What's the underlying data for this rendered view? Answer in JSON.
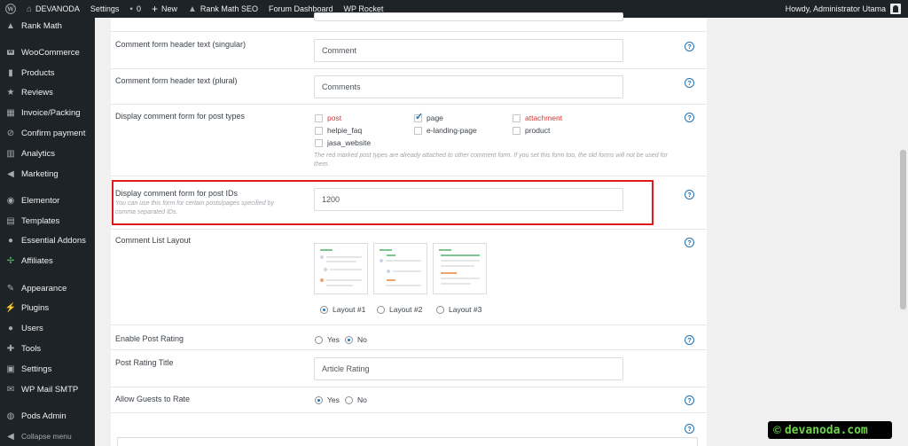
{
  "adminbar": {
    "site": "DEVANODA",
    "settings": "Settings",
    "comments_count": "0",
    "new": "New",
    "rankmath": "Rank Math SEO",
    "forum": "Forum Dashboard",
    "rocket": "WP Rocket",
    "howdy": "Howdy, Administrator Utama"
  },
  "sidebar": {
    "items": [
      {
        "label": "Rank Math",
        "icon": "rank-math-icon"
      },
      {
        "label": "WooCommerce",
        "icon": "woocommerce-icon"
      },
      {
        "label": "Products",
        "icon": "products-icon"
      },
      {
        "label": "Reviews",
        "icon": "star-icon"
      },
      {
        "label": "Invoice/Packing",
        "icon": "invoice-icon"
      },
      {
        "label": "Confirm payment",
        "icon": "payment-icon"
      },
      {
        "label": "Analytics",
        "icon": "analytics-icon"
      },
      {
        "label": "Marketing",
        "icon": "megaphone-icon"
      },
      {
        "label": "Elementor",
        "icon": "elementor-icon"
      },
      {
        "label": "Templates",
        "icon": "templates-icon"
      },
      {
        "label": "Essential Addons",
        "icon": "essential-addons-icon"
      },
      {
        "label": "Affiliates",
        "icon": "affiliates-icon"
      },
      {
        "label": "Appearance",
        "icon": "paintbrush-icon"
      },
      {
        "label": "Plugins",
        "icon": "plugin-icon"
      },
      {
        "label": "Users",
        "icon": "users-icon"
      },
      {
        "label": "Tools",
        "icon": "wrench-icon"
      },
      {
        "label": "Settings",
        "icon": "settings-icon"
      },
      {
        "label": "WP Mail SMTP",
        "icon": "mail-icon"
      },
      {
        "label": "Pods Admin",
        "icon": "pods-icon"
      }
    ],
    "collapse": "Collapse menu"
  },
  "form": {
    "header_singular": {
      "label": "Comment form header text (singular)",
      "value": "Comment"
    },
    "header_plural": {
      "label": "Comment form header text (plural)",
      "value": "Comments"
    },
    "post_types": {
      "label": "Display comment form for post types",
      "options": [
        {
          "label": "post",
          "checked": false,
          "red": true
        },
        {
          "label": "page",
          "checked": true,
          "red": false
        },
        {
          "label": "attachment",
          "checked": false,
          "red": true
        },
        {
          "label": "helpie_faq",
          "checked": false,
          "red": false
        },
        {
          "label": "e-landing-page",
          "checked": false,
          "red": false
        },
        {
          "label": "product",
          "checked": false,
          "red": false
        },
        {
          "label": "jasa_website",
          "checked": false,
          "red": false
        }
      ],
      "note": "The red marked post types are already attached to other comment form. If you set this form too, the old forms will not be used for them."
    },
    "post_ids": {
      "label": "Display comment form for post IDs",
      "desc": "You can use this form for certain posts/pages specified by comma separated IDs.",
      "value": "1200"
    },
    "list_layout": {
      "label": "Comment List Layout",
      "options": [
        {
          "label": "Layout #1",
          "selected": true
        },
        {
          "label": "Layout #2",
          "selected": false
        },
        {
          "label": "Layout #3",
          "selected": false
        }
      ]
    },
    "post_rating": {
      "label": "Enable Post Rating",
      "options": [
        {
          "label": "Yes",
          "selected": false
        },
        {
          "label": "No",
          "selected": true
        }
      ]
    },
    "rating_title": {
      "label": "Post Rating Title",
      "value": "Article Rating"
    },
    "guests_rate": {
      "label": "Allow Guests to Rate",
      "options": [
        {
          "label": "Yes",
          "selected": true
        },
        {
          "label": "No",
          "selected": false
        }
      ]
    },
    "help_glyph": "?"
  },
  "watermark": {
    "copy": "©",
    "text": "devanoda.com"
  },
  "colors": {
    "highlight": "#e0191c",
    "accent": "#2271b1",
    "sidebar": "#1d2327",
    "warning": "#d63638"
  }
}
